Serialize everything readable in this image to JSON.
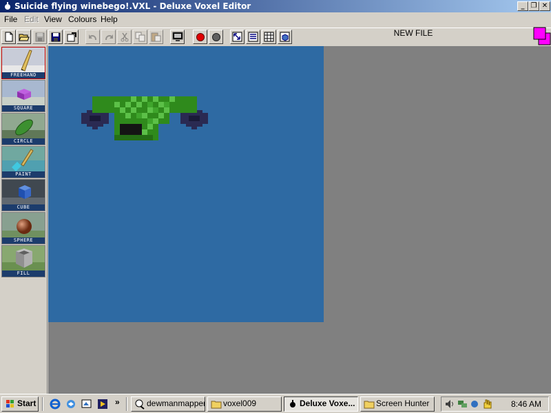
{
  "window": {
    "title": "Suicide flying winebego!.VXL - Deluxe Voxel Editor",
    "caption_buttons": {
      "minimize": "_",
      "restore": "❐",
      "close": "✕"
    }
  },
  "menu": [
    "File",
    "Edit",
    "View",
    "Colours",
    "Help"
  ],
  "toolbar": {
    "file_status": "NEW FILE",
    "active_colour": "#ff00ff"
  },
  "tools": [
    {
      "label": "FREEHAND",
      "icon": "pencil-icon",
      "selected": true
    },
    {
      "label": "SQUARE",
      "icon": "square-icon"
    },
    {
      "label": "CIRCLE",
      "icon": "circle-icon"
    },
    {
      "label": "PAINT",
      "icon": "paint-brush-icon"
    },
    {
      "label": "CUBE",
      "icon": "cube-icon"
    },
    {
      "label": "SPHERE",
      "icon": "sphere-icon"
    },
    {
      "label": "FILL",
      "icon": "fill-bucket-icon"
    }
  ],
  "canvas": {
    "background": "#2e6aa3"
  },
  "taskbar": {
    "start_label": "Start",
    "quick_launch_more": "»",
    "tasks": [
      {
        "label": "dewmanmapper...",
        "icon": "app-icon",
        "active": false
      },
      {
        "label": "voxel009",
        "icon": "folder-icon",
        "active": false
      },
      {
        "label": "Deluxe Voxe...",
        "icon": "app-icon",
        "active": true
      },
      {
        "label": "Screen Hunter",
        "icon": "folder-icon",
        "active": false
      }
    ],
    "clock": "8:46 AM"
  }
}
